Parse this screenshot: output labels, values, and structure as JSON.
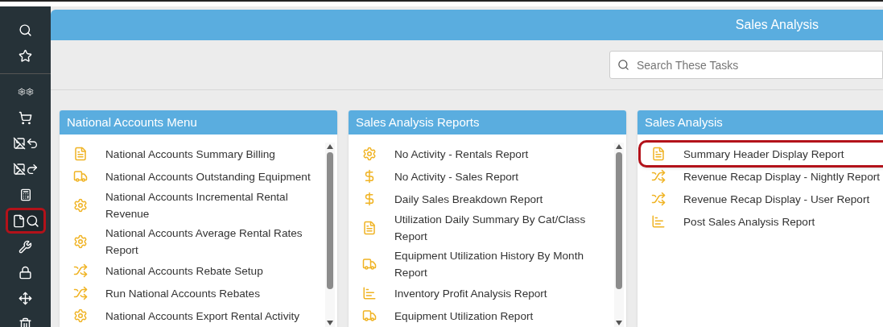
{
  "sidebar": {
    "groups": [
      [
        {
          "kind": "search",
          "selected": false
        },
        {
          "kind": "star",
          "selected": false
        }
      ],
      [
        {
          "kind": "gears",
          "selected": false
        },
        {
          "kind": "cart",
          "selected": false
        },
        {
          "kind": "image-back",
          "selected": false
        },
        {
          "kind": "image-forward",
          "selected": false
        },
        {
          "kind": "calculator",
          "selected": false
        },
        {
          "kind": "file-search",
          "selected": true
        },
        {
          "kind": "wrench",
          "selected": false
        },
        {
          "kind": "lock",
          "selected": false
        },
        {
          "kind": "move",
          "selected": false
        },
        {
          "kind": "trash",
          "selected": false
        }
      ]
    ]
  },
  "header": {
    "title": "Sales Analysis"
  },
  "search": {
    "placeholder": "Search These Tasks"
  },
  "panels": [
    {
      "title": "National Accounts Menu",
      "scrollbar": true,
      "items": [
        {
          "kind": "document",
          "label": "National Accounts Summary Billing",
          "selected": false
        },
        {
          "kind": "truck",
          "label": "National Accounts Outstanding Equipment",
          "selected": false
        },
        {
          "kind": "gear",
          "label": "National Accounts Incremental Rental Revenue",
          "selected": false
        },
        {
          "kind": "gear",
          "label": "National Accounts Average Rental Rates Report",
          "selected": false
        },
        {
          "kind": "shuffle",
          "label": "National Accounts Rebate Setup",
          "selected": false
        },
        {
          "kind": "shuffle",
          "label": "Run National Accounts Rebates",
          "selected": false
        },
        {
          "kind": "gear",
          "label": "National Accounts Export Rental Activity",
          "selected": false
        }
      ]
    },
    {
      "title": "Sales Analysis Reports",
      "scrollbar": true,
      "items": [
        {
          "kind": "gear",
          "label": "No Activity - Rentals Report",
          "selected": false
        },
        {
          "kind": "dollar",
          "label": "No Activity - Sales Report",
          "selected": false
        },
        {
          "kind": "dollar",
          "label": "Daily Sales Breakdown Report",
          "selected": false
        },
        {
          "kind": "document",
          "label": "Utilization Daily Summary By Cat/Class Report",
          "selected": false
        },
        {
          "kind": "truck",
          "label": "Equipment Utilization History By Month Report",
          "selected": false
        },
        {
          "kind": "chart",
          "label": "Inventory Profit Analysis Report",
          "selected": false
        },
        {
          "kind": "truck",
          "label": "Equipment Utilization Report",
          "selected": false
        }
      ]
    },
    {
      "title": "Sales Analysis",
      "scrollbar": false,
      "items": [
        {
          "kind": "document",
          "label": "Summary Header Display Report",
          "selected": true
        },
        {
          "kind": "shuffle",
          "label": "Revenue Recap Display - Nightly Report",
          "selected": false
        },
        {
          "kind": "shuffle",
          "label": "Revenue Recap Display - User Report",
          "selected": false
        },
        {
          "kind": "chart",
          "label": "Post Sales Analysis Report",
          "selected": false
        }
      ]
    }
  ]
}
